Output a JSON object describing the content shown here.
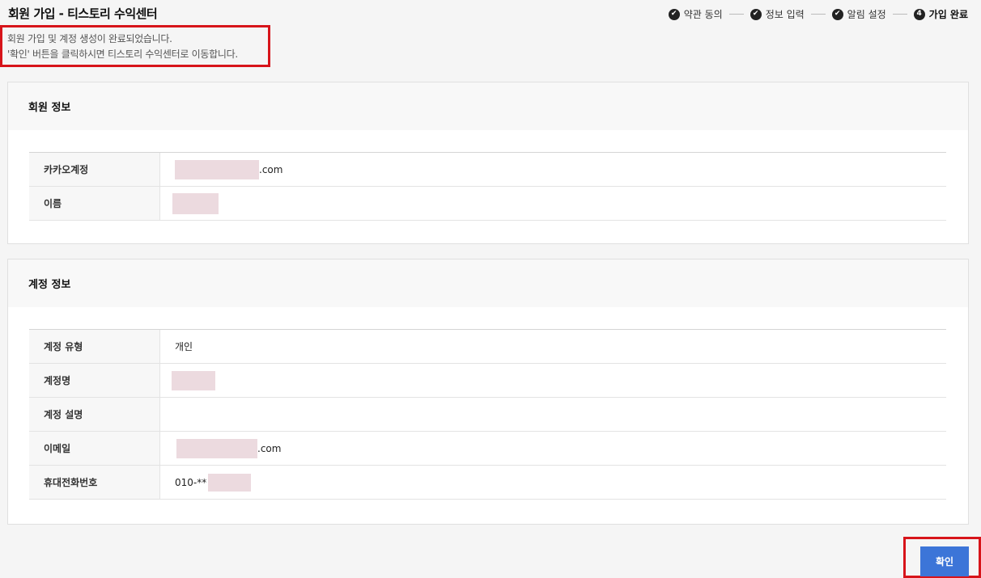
{
  "header": {
    "title": "회원 가입 - 티스토리 수익센터"
  },
  "steps": [
    {
      "mark": "✔",
      "label": "약관 동의",
      "state": "done"
    },
    {
      "mark": "✔",
      "label": "정보 입력",
      "state": "done"
    },
    {
      "mark": "✔",
      "label": "알림 설정",
      "state": "done"
    },
    {
      "mark": "4",
      "label": "가입 완료",
      "state": "current"
    }
  ],
  "notice": {
    "line1": "회원 가입 및 계정 생성이 완료되었습니다.",
    "line2": "'확인' 버튼을 클릭하시면 티스토리 수익센터로 이동합니다."
  },
  "member_info": {
    "title": "회원 정보",
    "rows": [
      {
        "label": "카카오계정",
        "value": ".com"
      },
      {
        "label": "이름",
        "value": ""
      }
    ]
  },
  "account_info": {
    "title": "계정 정보",
    "rows": [
      {
        "label": "계정 유형",
        "value": "개인"
      },
      {
        "label": "계정명",
        "value": ""
      },
      {
        "label": "계정 설명",
        "value": ""
      },
      {
        "label": "이메일",
        "value": ".com"
      },
      {
        "label": "휴대전화번호",
        "value": "010-**"
      }
    ]
  },
  "actions": {
    "confirm_label": "확인"
  },
  "colors": {
    "highlight": "#d7141a",
    "primary_button": "#3c75d8",
    "redaction": "#ecdadf"
  }
}
